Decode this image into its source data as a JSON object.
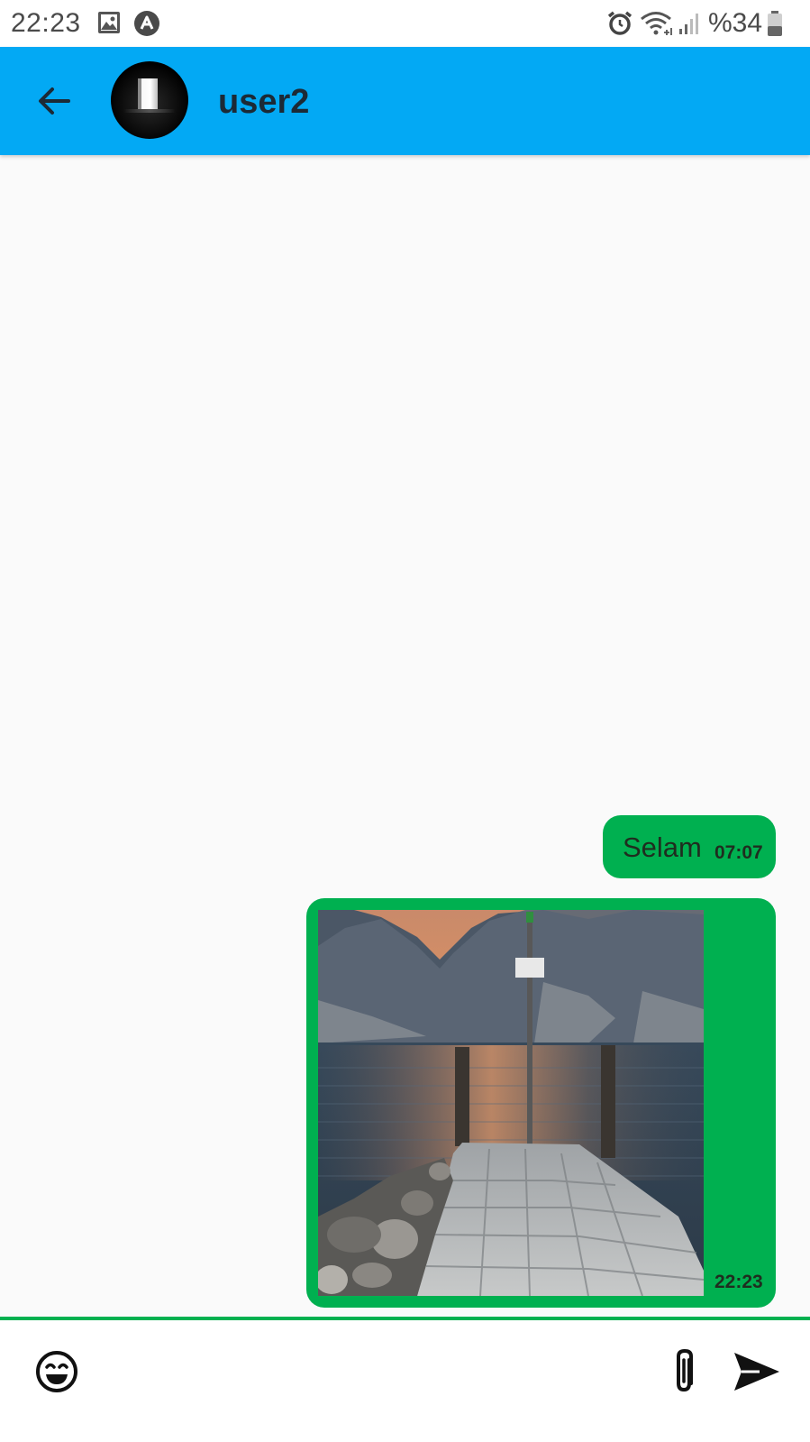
{
  "status_bar": {
    "time": "22:23",
    "battery": "%34",
    "icons": [
      "gallery-icon",
      "a-letter-icon",
      "alarm-icon",
      "wifi-icon",
      "signal-icon",
      "battery-icon"
    ]
  },
  "header": {
    "contact_name": "user2",
    "back_icon": "arrow-left-icon",
    "avatar": "door-avatar"
  },
  "messages": [
    {
      "type": "text",
      "text": "Selam",
      "time": "07:07",
      "outgoing": true
    },
    {
      "type": "image",
      "image": "lake-pier-sunset-photo",
      "time": "22:23",
      "outgoing": true
    }
  ],
  "input_bar": {
    "placeholder": "",
    "value": "",
    "icons": [
      "emoji-icon",
      "paperclip-icon",
      "send-icon"
    ]
  },
  "colors": {
    "app_bar": "#03a9f4",
    "bubble": "#00b050",
    "background": "#fafafa",
    "accent_line": "#00b050"
  }
}
